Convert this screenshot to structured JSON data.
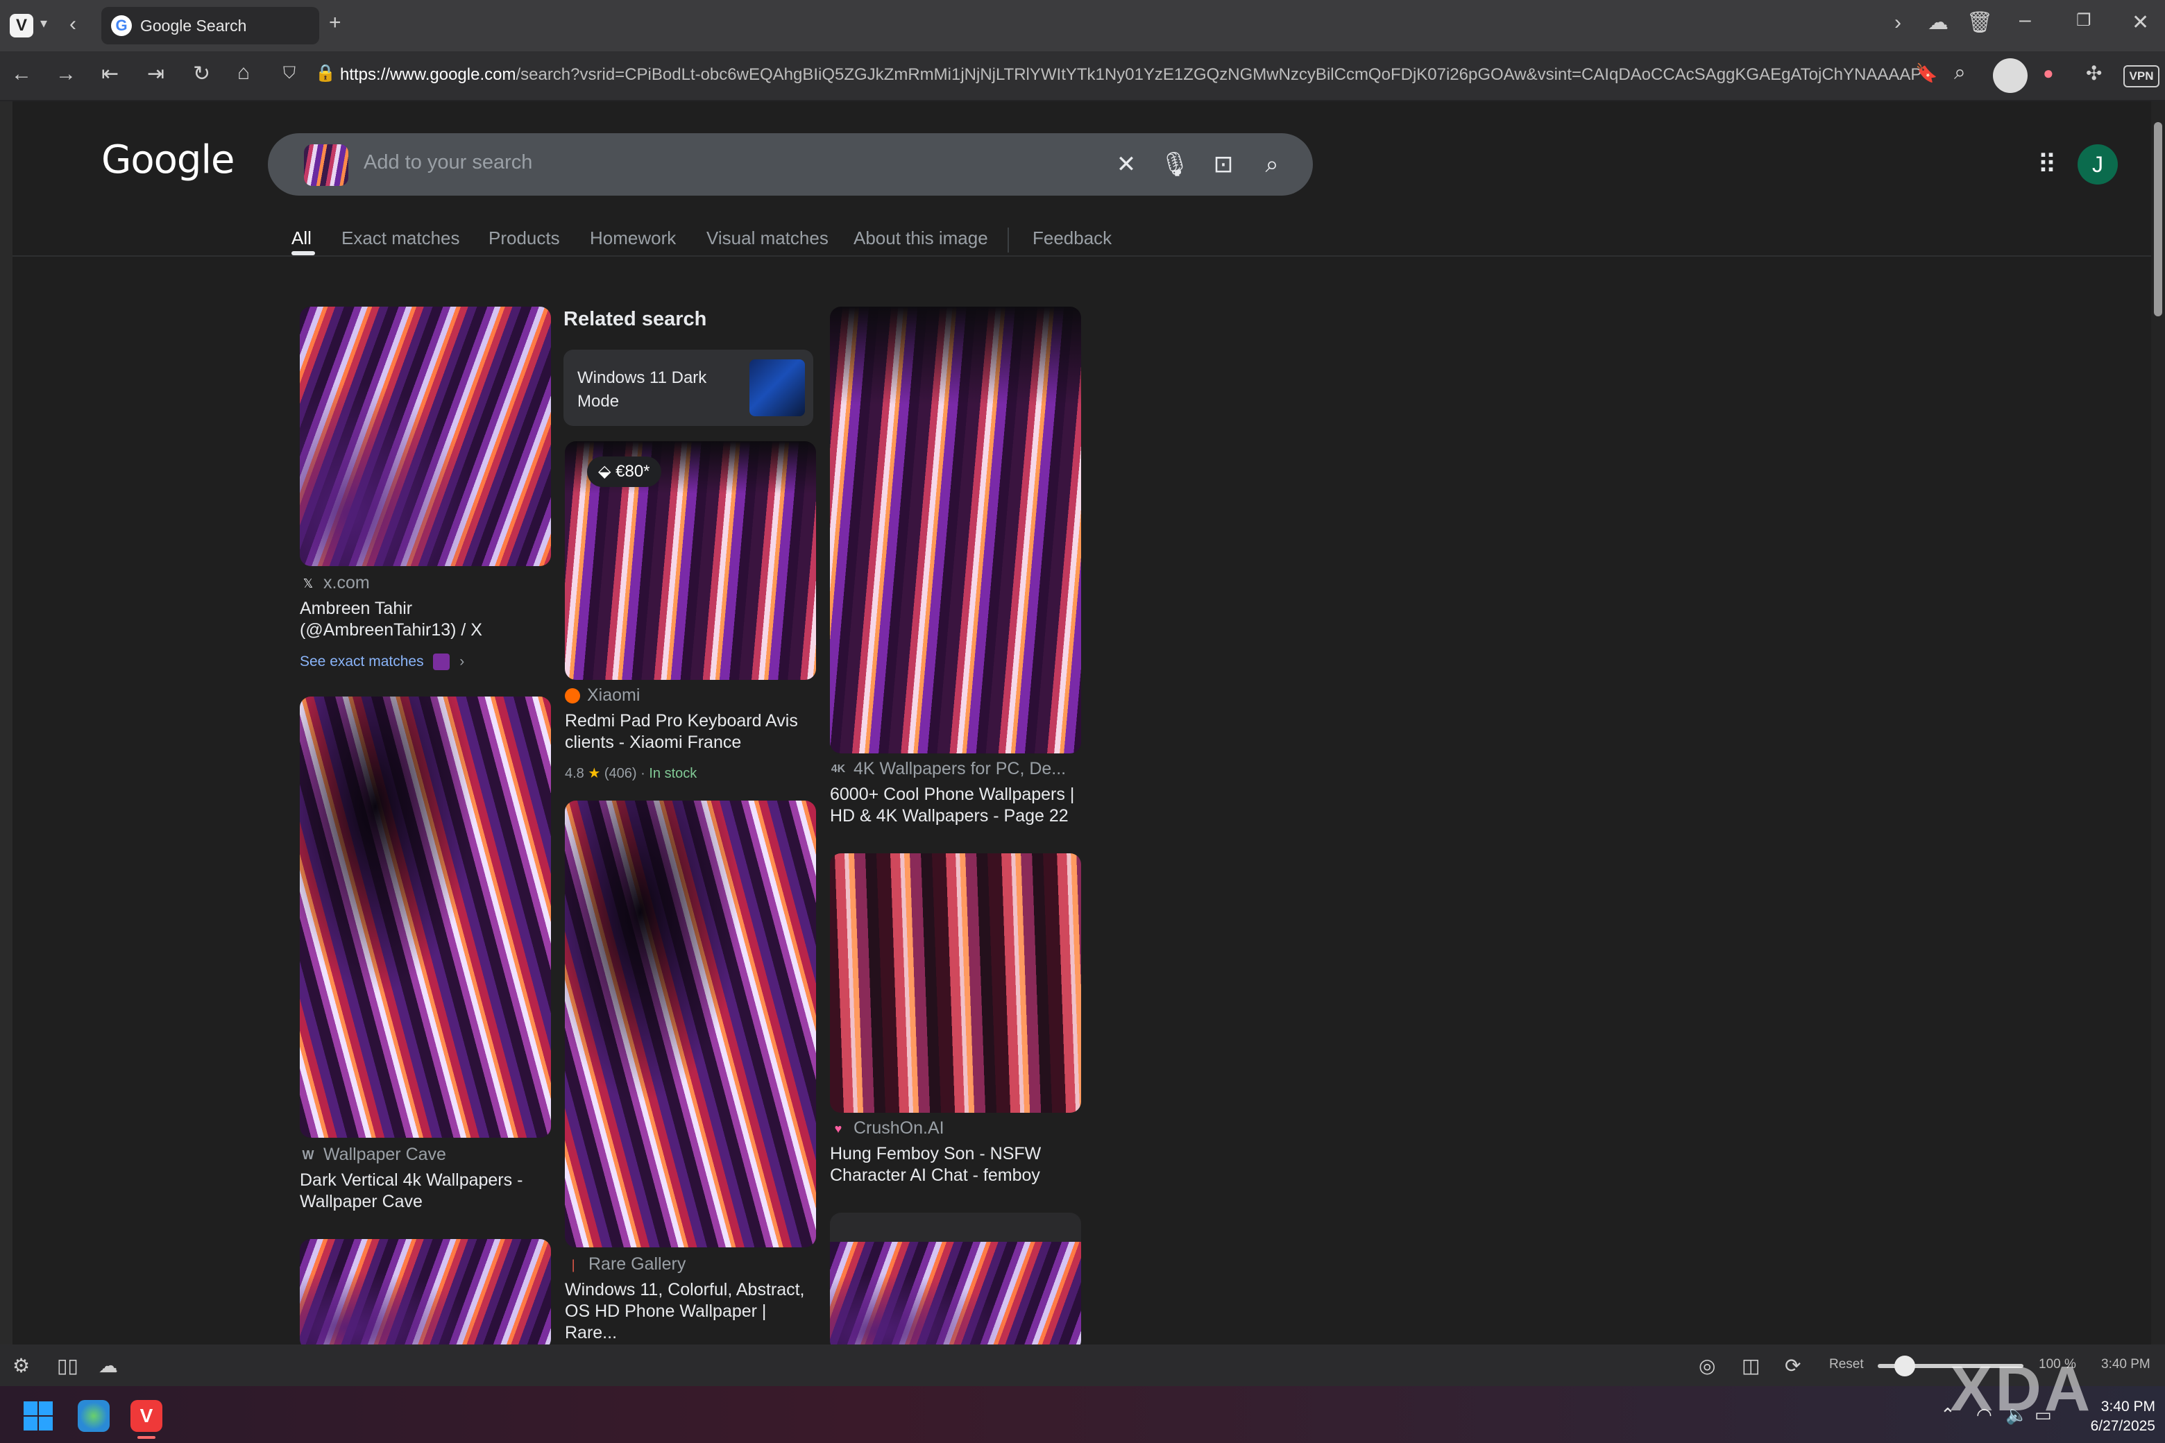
{
  "browser": {
    "tab_title": "Google Search",
    "url_domain": "https://www.google.com",
    "url_rest": "/search?vsrid=CPiBodLt-obc6wEQAhgBIiQ5ZGJkZmRmMi1jNjNjLTRlYWItYTk1Ny01YzE1ZGQzNGMwNzcyBilCcmQoFDjK07i26pGOAw&vsint=CAIqDAoCCAcSAggKGAEgATojChYNAAAAPxUAAAA_HQAA...",
    "vpn_label": "VPN",
    "accent_color": "#ef3939"
  },
  "google": {
    "logo": "Google",
    "search_placeholder": "Add to your search",
    "account_initial": "J",
    "tabs": [
      "All",
      "Exact matches",
      "Products",
      "Homework",
      "Visual matches",
      "About this image",
      "Feedback"
    ],
    "active_tab": "All"
  },
  "results": {
    "col1": [
      {
        "source": "x.com",
        "source_icon": "x-icon",
        "title": "Ambreen Tahir (@AmbreenTahir13) / X",
        "link": "See exact matches"
      },
      {
        "source": "Wallpaper Cave",
        "source_icon": "wallpapercave-icon",
        "title": "Dark Vertical 4k Wallpapers - Wallpaper Cave"
      }
    ],
    "col2": {
      "related_heading": "Related search",
      "related_chip": "Windows 11 Dark Mode",
      "items": [
        {
          "price": "€80*",
          "source": "Xiaomi",
          "source_icon": "xiaomi-icon",
          "title": "Redmi Pad Pro Keyboard Avis clients - Xiaomi France",
          "rating": "4.8",
          "reviews": "(406)",
          "stock": "In stock"
        },
        {
          "source": "Rare Gallery",
          "source_icon": "raregallery-icon",
          "title": "Windows 11, Colorful, Abstract, OS HD Phone Wallpaper | Rare..."
        }
      ]
    },
    "col3": [
      {
        "source": "4K Wallpapers for PC, De...",
        "source_icon": "4kwallpapers-icon",
        "title": "6000+ Cool Phone Wallpapers | HD & 4K Wallpapers - Page 22"
      },
      {
        "source": "CrushOn.AI",
        "source_icon": "crushon-icon",
        "title": "Hung Femboy Son - NSFW Character AI Chat - femboy"
      }
    ]
  },
  "statusbar": {
    "reset_label": "Reset",
    "zoom": "100 %",
    "time": "3:40 PM"
  },
  "taskbar": {
    "time": "3:40 PM",
    "date": "6/27/2025"
  },
  "watermark": "XDA"
}
